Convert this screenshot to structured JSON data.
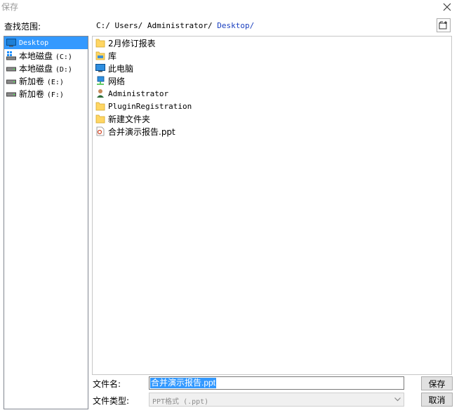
{
  "window": {
    "title": "保存"
  },
  "lookin": {
    "label": "查找范围:",
    "path_segments": [
      "C:/",
      "Users/",
      "Administrator/"
    ],
    "current": "Desktop/"
  },
  "locations": [
    {
      "label": "Desktop",
      "icon": "desktop-icon",
      "selected": true
    },
    {
      "label": "本地磁盘",
      "drive": "(C:)",
      "icon": "system-drive-icon"
    },
    {
      "label": "本地磁盘",
      "drive": "(D:)",
      "icon": "drive-icon"
    },
    {
      "label": "新加卷",
      "drive": "(E:)",
      "icon": "drive-icon"
    },
    {
      "label": "新加卷",
      "drive": "(F:)",
      "icon": "drive-icon"
    }
  ],
  "files": [
    {
      "name": "2月修订报表",
      "icon": "folder-icon",
      "mono": false
    },
    {
      "name": "库",
      "icon": "library-icon",
      "mono": false
    },
    {
      "name": "此电脑",
      "icon": "computer-icon",
      "mono": false
    },
    {
      "name": "网络",
      "icon": "network-icon",
      "mono": false
    },
    {
      "name": "Administrator",
      "icon": "user-icon",
      "mono": true
    },
    {
      "name": "PluginRegistration",
      "icon": "folder-icon",
      "mono": true
    },
    {
      "name": "新建文件夹",
      "icon": "folder-icon",
      "mono": false
    },
    {
      "name": "合并演示报告.ppt",
      "icon": "ppt-file-icon",
      "mono": false
    }
  ],
  "filename": {
    "label": "文件名:",
    "value": "合并演示报告.ppt"
  },
  "filetype": {
    "label": "文件类型:",
    "value": "PPT格式 (.ppt)"
  },
  "buttons": {
    "save": "保存",
    "cancel": "取消"
  },
  "colors": {
    "selection": "#3399ff",
    "path_current": "#1a3fbf",
    "folder": "#ffd663"
  }
}
